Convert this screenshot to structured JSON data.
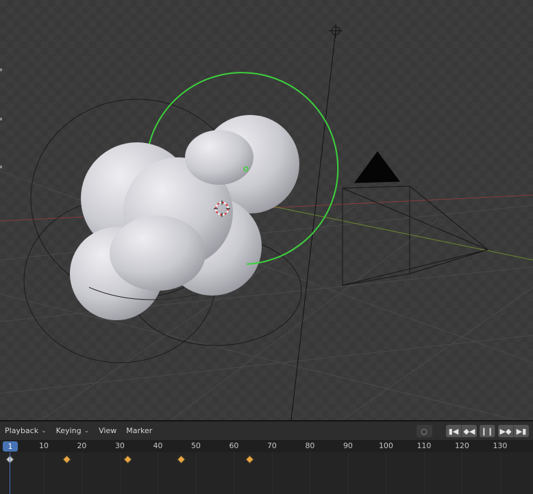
{
  "timeline": {
    "menus": [
      {
        "label": "Playback",
        "dropdown": true
      },
      {
        "label": "Keying",
        "dropdown": true
      },
      {
        "label": "View",
        "dropdown": false
      },
      {
        "label": "Marker",
        "dropdown": false
      }
    ],
    "current_frame": "1",
    "ruler_ticks": [
      "10",
      "20",
      "30",
      "40",
      "50",
      "60",
      "70",
      "80",
      "90",
      "100",
      "110",
      "120",
      "130"
    ],
    "keyframes": [
      1,
      16,
      32,
      46,
      64
    ],
    "controls": {
      "record_icon": "record-icon",
      "jump_start_icon": "jump-to-start-icon",
      "prev_key_icon": "previous-keyframe-icon",
      "pause_icon": "pause-icon",
      "next_key_icon": "next-keyframe-icon",
      "jump_end_icon": "jump-to-end-icon"
    }
  },
  "viewport": {
    "object": "metaball-blob",
    "colors": {
      "background": "#3a3a3a",
      "rotate_gizmo": "#3cd23c",
      "x_axis": "#8a3d3d",
      "y_axis": "#6d8a2d",
      "keyframe": "#e8a640",
      "playhead": "#4772b3"
    }
  }
}
